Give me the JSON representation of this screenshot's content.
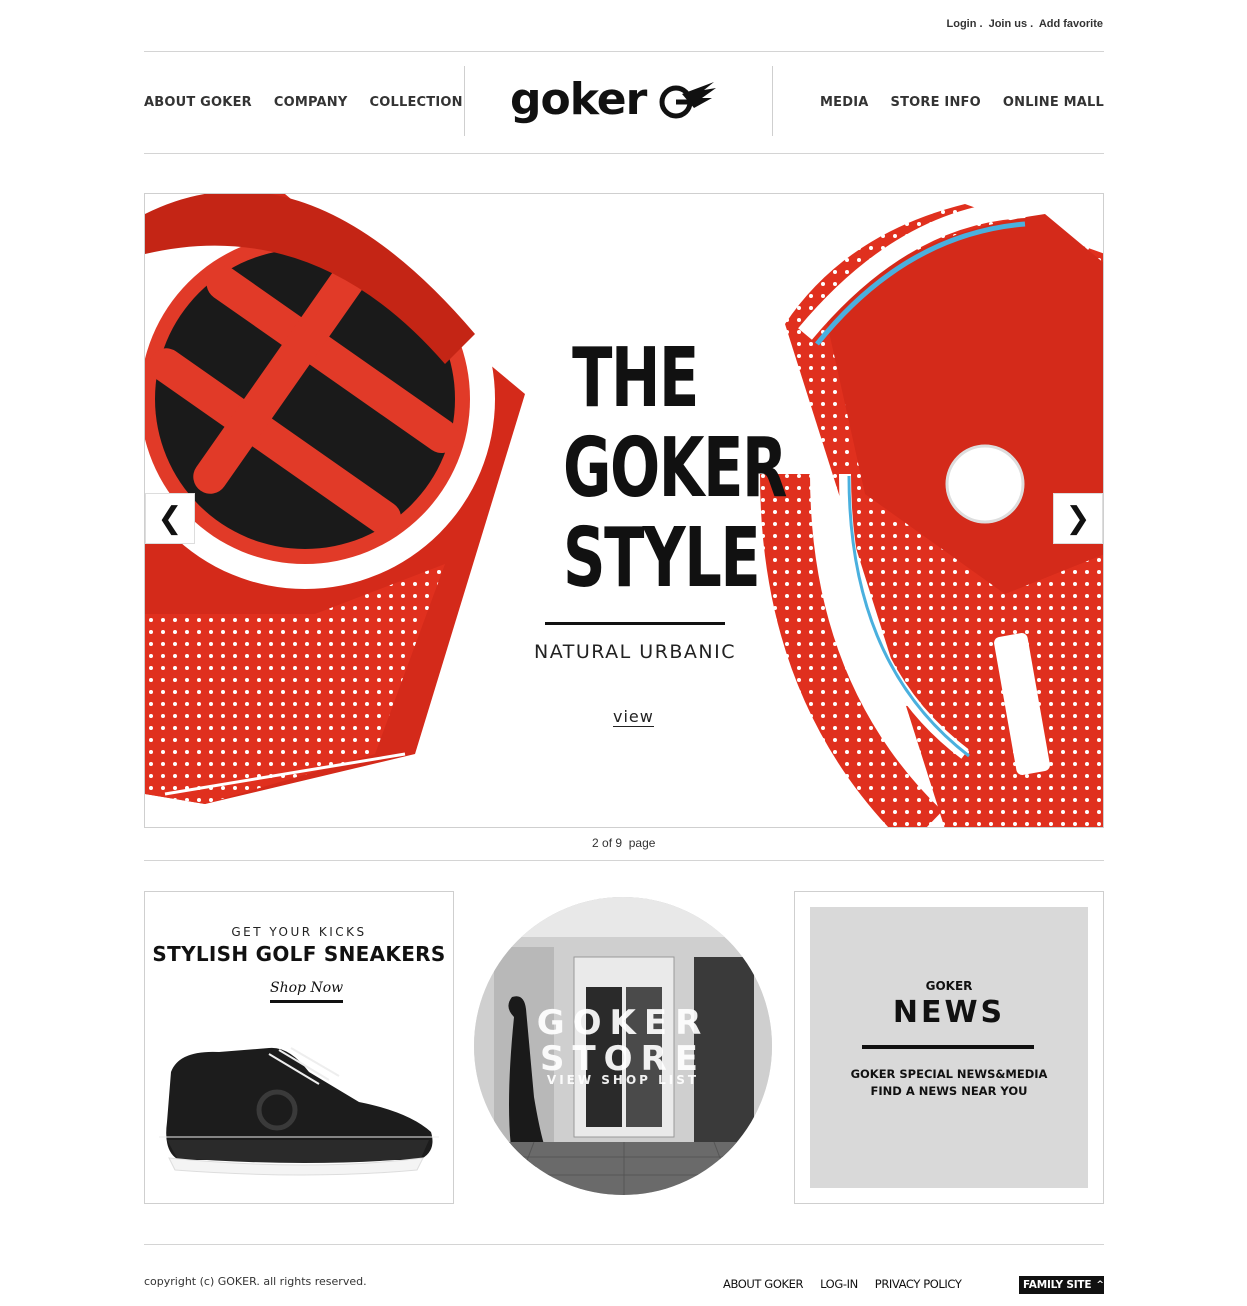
{
  "util": {
    "login": "Login",
    "join": "Join us",
    "favorite": "Add favorite",
    "separator": "."
  },
  "nav": {
    "left": [
      "ABOUT GOKER",
      "COMPANY",
      "COLLECTION"
    ],
    "right": [
      "MEDIA",
      "STORE INFO",
      "ONLINE MALL"
    ],
    "logo": "goker"
  },
  "hero": {
    "title_lines": [
      "THE",
      "GOKER",
      "STYLE"
    ],
    "subtitle": "NATURAL URBANIC",
    "view": "view",
    "prev_icon": "chevron-left-icon",
    "next_icon": "chevron-right-icon",
    "prev_glyph": "❮",
    "next_glyph": "❯"
  },
  "pager": {
    "current": "2",
    "of": "of",
    "total": "9",
    "suffix": "page"
  },
  "cards": {
    "sneaker": {
      "kicker": "GET YOUR KICKS",
      "title": "STYLISH GOLF SNEAKERS",
      "cta": "Shop Now"
    },
    "store": {
      "line1": "GOKER",
      "line2": "STORE",
      "sub": "VIEW SHOP LIST"
    },
    "news": {
      "kicker": "GOKER",
      "title": "NEWS",
      "line1": "GOKER SPECIAL NEWS&MEDIA",
      "line2": "FIND A NEWS NEAR YOU"
    }
  },
  "footer": {
    "copyright": "copyright (c) GOKER. all rights reserved.",
    "links": [
      "ABOUT GOKER",
      "LOG-IN",
      "PRIVACY POLICY"
    ],
    "family_site": "FAMILY SITE",
    "family_glyph": "^"
  },
  "colors": {
    "accent_red": "#e0301e",
    "text_dark": "#111111",
    "line_gray": "#d4d4d4",
    "news_bg": "#d9d9d9"
  }
}
